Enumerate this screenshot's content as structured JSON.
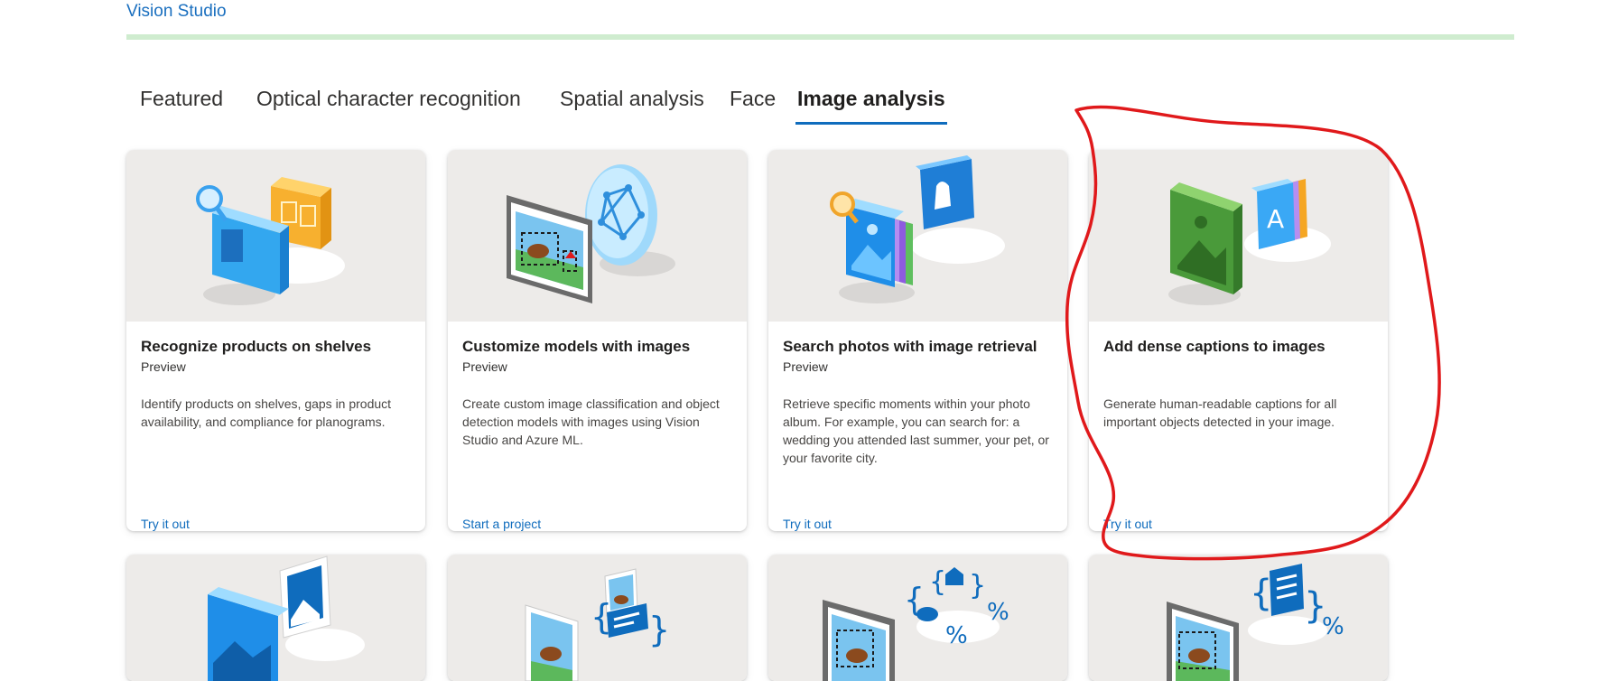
{
  "app": {
    "brand": "Vision Studio",
    "progress": 1.0
  },
  "tabs": [
    {
      "label": "Featured"
    },
    {
      "label": "Optical character recognition"
    },
    {
      "label": "Spatial analysis"
    },
    {
      "label": "Face"
    },
    {
      "label": "Image analysis",
      "active": true
    }
  ],
  "cards": [
    {
      "title": "Recognize products on shelves",
      "subtitle": "Preview",
      "description": "Identify products on shelves, gaps in product availability, and compliance for planograms.",
      "link": "Try it out",
      "icon": "product-shelf-icon"
    },
    {
      "title": "Customize models with images",
      "subtitle": "Preview",
      "description": "Create custom image classification and object detection models with images using Vision Studio and Azure ML.",
      "link": "Start a project",
      "icon": "custom-model-icon"
    },
    {
      "title": "Search photos with image retrieval",
      "subtitle": "Preview",
      "description": "Retrieve specific moments within your photo album. For example, you can search for: a wedding you attended last summer, your pet, or your favorite city.",
      "link": "Try it out",
      "icon": "photo-search-icon"
    },
    {
      "title": "Add dense captions to images",
      "subtitle": "",
      "description": "Generate human-readable captions for all important objects detected in your image.",
      "link": "Try it out",
      "icon": "dense-captions-icon"
    }
  ],
  "cards_row2": [
    {
      "icon": "image-pair-icon"
    },
    {
      "icon": "image-caption-icon"
    },
    {
      "icon": "object-tags-icon"
    },
    {
      "icon": "image-tags-icon"
    }
  ],
  "colors": {
    "accent": "#0f6cbd",
    "annotation": "#e0191b",
    "hero_bg": "#edebe9"
  }
}
